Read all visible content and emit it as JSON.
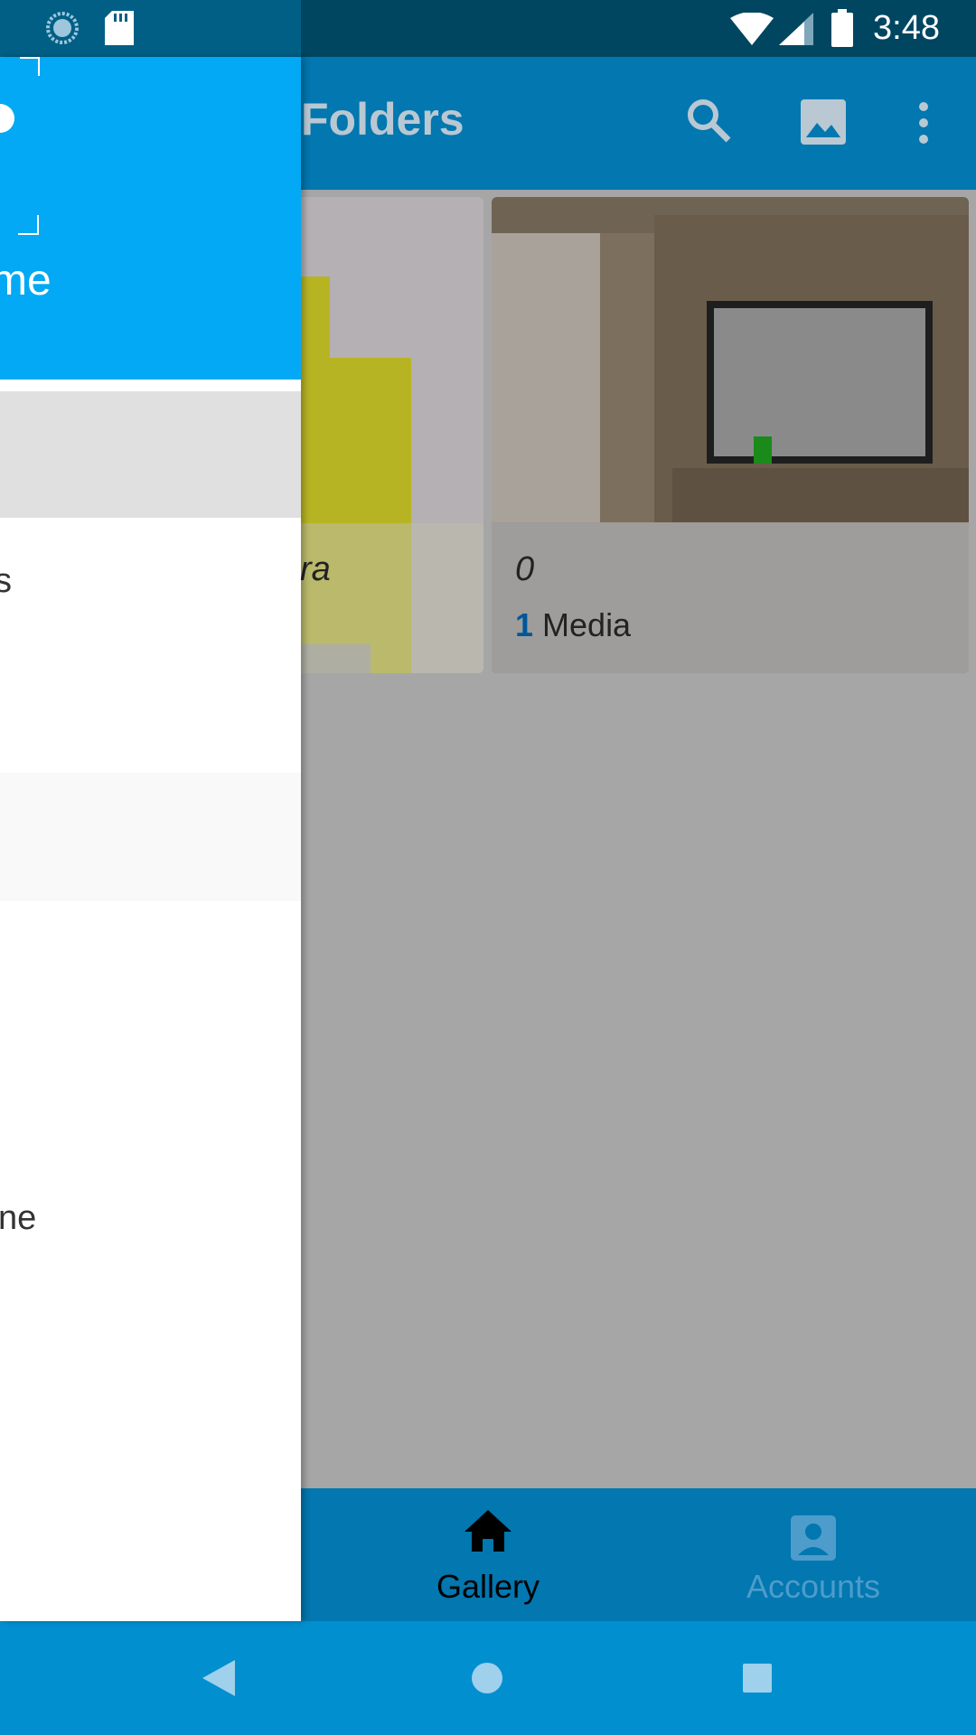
{
  "status_bar": {
    "time": "3:48"
  },
  "app_bar": {
    "title": "Folders"
  },
  "folders": [
    {
      "name": "ra",
      "count": "",
      "count_label": ""
    },
    {
      "name": "0",
      "count": "1",
      "count_label": "Media"
    }
  ],
  "bottom_nav": {
    "items": [
      {
        "label": "Gallery",
        "icon": "home-icon",
        "active": true
      },
      {
        "label": "Accounts",
        "icon": "account-icon",
        "active": false
      }
    ]
  },
  "drawer": {
    "header_text": "me",
    "items": [
      {
        "label": "s"
      },
      {
        "label": "ne"
      }
    ]
  },
  "colors": {
    "status_bar": "#014661",
    "app_bar": "#0277b0",
    "drawer_header": "#03a9f4",
    "count_number": "#01579b",
    "system_nav": "#028fcf"
  }
}
